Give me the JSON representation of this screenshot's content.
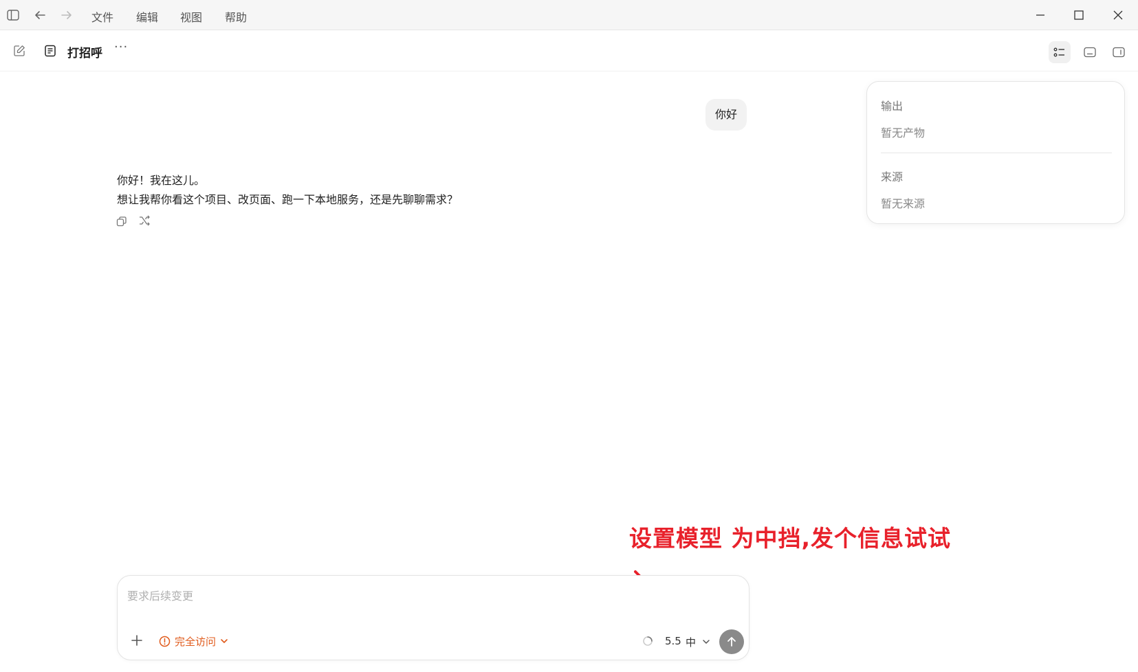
{
  "menu": {
    "file": "文件",
    "edit": "编辑",
    "view": "视图",
    "help": "帮助"
  },
  "document": {
    "title": "打招呼",
    "more_label": "···"
  },
  "conversation": {
    "user_message": "你好",
    "assistant_line1": "你好！我在这儿。",
    "assistant_line2": "想让我帮你看这个项目、改页面、跑一下本地服务，还是先聊聊需求？"
  },
  "side_panel": {
    "output_heading": "输出",
    "output_empty": "暂无产物",
    "source_heading": "来源",
    "source_empty": "暂无来源"
  },
  "annotation": {
    "text": "设置模型 为中挡,发个信息试试",
    "color": "#e8212b"
  },
  "composer": {
    "placeholder": "要求后续变更",
    "access_label": "完全访问",
    "model_version": "5.5",
    "reasoning_level": "中"
  },
  "colors": {
    "accent_orange": "#e05a1b",
    "send_button": "#8a8a8a"
  }
}
